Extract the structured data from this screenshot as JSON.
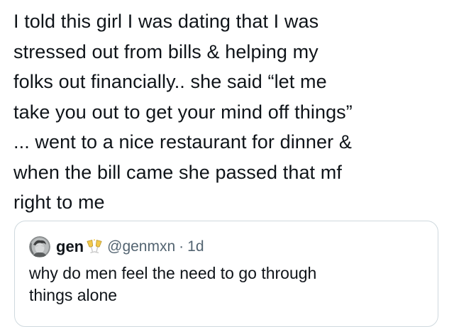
{
  "post": {
    "text": "I told this girl I was dating that I was\nstressed out from bills & helping my\nfolks out financially.. she said “let me\ntake you out to get your mind off things”\n... went to a nice restaurant for dinner &\nwhen the bill came she passed that mf\nright to me"
  },
  "quoted_post": {
    "avatar_icon": "profile-avatar",
    "display_name": "gen",
    "name_emoji_icon": "clinking-glasses-emoji",
    "handle": "@genmxn",
    "separator": "·",
    "time": "1d",
    "text": "why do men feel the need to go through\nthings alone"
  },
  "colors": {
    "text_primary": "#0f1419",
    "text_secondary": "#536471",
    "card_border": "#cfd9de",
    "background": "#ffffff"
  }
}
